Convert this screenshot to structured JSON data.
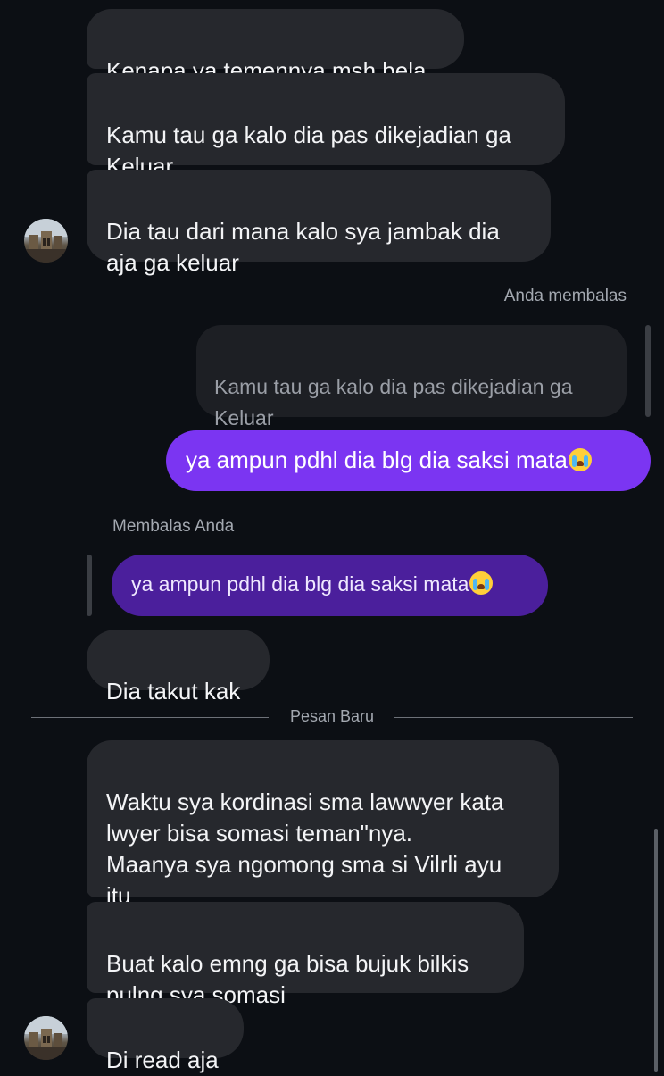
{
  "messages": {
    "m1": "Kenapa ya temennya msh bela",
    "m2": "Kamu tau ga kalo dia pas dikejadian ga\nKeluar",
    "m3": "Dia tau dari mana kalo sya jambak dia\naja ga keluar",
    "reply_label_you": "Anda membalas",
    "quoted_incoming": "Kamu tau ga kalo dia pas dikejadian ga\nKeluar",
    "out_text": "ya ampun pdhl dia blg dia saksi mata",
    "reply_label_them": "Membalas Anda",
    "quoted_outgoing": "ya ampun pdhl dia blg dia saksi mata",
    "m4": "Dia takut kak",
    "new_messages_label": "Pesan Baru",
    "m5": "Waktu sya kordinasi sma lawwyer kata\nlwyer bisa somasi teman\"nya.\nMaanya sya ngomong sma si Vilrli ayu\nitu",
    "m6": "Buat kalo emng ga bisa bujuk bilkis\npulng sya somasi",
    "m7": "Di read aja"
  },
  "emoji": "loudly-crying-face",
  "colors": {
    "background": "#0c0f14",
    "incoming_bubble": "#26282d",
    "outgoing_bubble": "#7b35f2",
    "quoted_outgoing_bubble": "#4b1f9c",
    "meta_text": "#a3a8b0"
  }
}
